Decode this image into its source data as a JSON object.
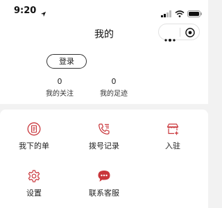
{
  "status_bar": {
    "time": "9:20",
    "icons": [
      "location-arrow-icon",
      "signal-icon",
      "wifi-icon",
      "battery-icon"
    ]
  },
  "nav": {
    "title": "我的",
    "capsule_icons": [
      "more-dots-icon",
      "close-target-icon"
    ]
  },
  "profile": {
    "login_label": "登录",
    "stats": [
      {
        "value": "0",
        "label": "我的关注"
      },
      {
        "value": "0",
        "label": "我的足迹"
      }
    ]
  },
  "menu": {
    "items": [
      {
        "label": "我下的单",
        "icon": "order-list-icon"
      },
      {
        "label": "拨号记录",
        "icon": "phone-call-icon"
      },
      {
        "label": "入驻",
        "icon": "shop-add-icon"
      },
      {
        "label": "设置",
        "icon": "gear-icon"
      },
      {
        "label": "联系客服",
        "icon": "chat-bubble-icon"
      }
    ]
  },
  "colors": {
    "accent": "#c9363b",
    "background": "#f2f2f2",
    "card": "#ffffff",
    "text": "#222222"
  }
}
